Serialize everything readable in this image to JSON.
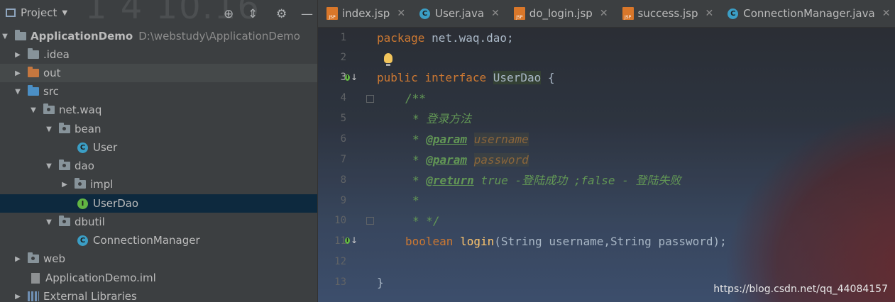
{
  "project_panel": {
    "title": "Project",
    "watermark": "1 4 10.16"
  },
  "tree": [
    {
      "label": "ApplicationDemo",
      "path": "D:\\webstudy\\ApplicationDemo"
    },
    {
      "label": ".idea"
    },
    {
      "label": "out"
    },
    {
      "label": "src"
    },
    {
      "label": "net.waq"
    },
    {
      "label": "bean"
    },
    {
      "label": "User"
    },
    {
      "label": "dao"
    },
    {
      "label": "impl"
    },
    {
      "label": "UserDao"
    },
    {
      "label": "dbutil"
    },
    {
      "label": "ConnectionManager"
    },
    {
      "label": "web"
    },
    {
      "label": "ApplicationDemo.iml"
    },
    {
      "label": "External Libraries"
    }
  ],
  "tabs": [
    {
      "label": "index.jsp",
      "type": "jsp"
    },
    {
      "label": "User.java",
      "type": "class"
    },
    {
      "label": "do_login.jsp",
      "type": "jsp"
    },
    {
      "label": "success.jsp",
      "type": "jsp"
    },
    {
      "label": "ConnectionManager.java",
      "type": "class"
    }
  ],
  "editor": {
    "line_numbers": [
      "1",
      "2",
      "3",
      "4",
      "5",
      "6",
      "7",
      "8",
      "9",
      "10",
      "11",
      "12",
      "13"
    ],
    "line1": {
      "kw": "package",
      "rest": " net.waq.dao;"
    },
    "line3": {
      "kw1": "public",
      "kw2": "interface",
      "name": "UserDao",
      "rest": " {"
    },
    "line4": "/**",
    "line5": "* 登录方法",
    "line6": {
      "star": "* ",
      "tag": "@param",
      "param": "username"
    },
    "line7": {
      "star": "* ",
      "tag": "@param",
      "param": "password"
    },
    "line8": {
      "star": "* ",
      "tag": "@return",
      "rest": " true -登陆成功 ;false - 登陆失败"
    },
    "line9": "*",
    "line10": "* */",
    "line11": {
      "kw": "boolean",
      "fn": "login",
      "rest": "(String username,String password);"
    },
    "line13": "}"
  },
  "watermark_url": "https://blog.csdn.net/qq_44084157"
}
